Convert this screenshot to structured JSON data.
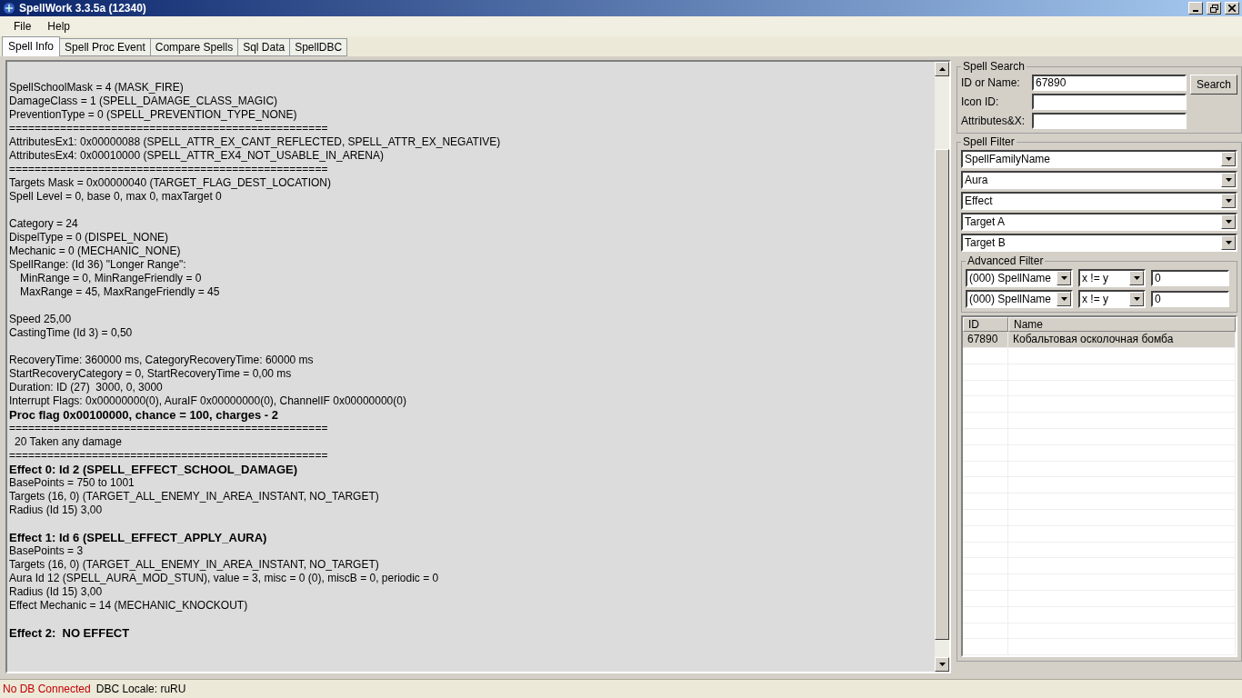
{
  "window": {
    "title": "SpellWork 3.3.5a (12340)"
  },
  "menu": [
    "File",
    "Help"
  ],
  "tabs": [
    {
      "label": "Spell Info",
      "selected": true
    },
    {
      "label": "Spell Proc Event",
      "selected": false
    },
    {
      "label": "Compare Spells",
      "selected": false
    },
    {
      "label": "Sql Data",
      "selected": false
    },
    {
      "label": "SpellDBC",
      "selected": false
    }
  ],
  "info_lines": [
    {
      "kind": "blank"
    },
    {
      "kind": "plain",
      "text": "SpellSchoolMask = 4 (MASK_FIRE)"
    },
    {
      "kind": "plain",
      "text": "DamageClass = 1 (SPELL_DAMAGE_CLASS_MAGIC)"
    },
    {
      "kind": "plain",
      "text": "PreventionType = 0 (SPELL_PREVENTION_TYPE_NONE)"
    },
    {
      "kind": "rule",
      "text": "=================================================="
    },
    {
      "kind": "plain",
      "text": "AttributesEx1: 0x00000088 (SPELL_ATTR_EX_CANT_REFLECTED, SPELL_ATTR_EX_NEGATIVE)"
    },
    {
      "kind": "plain",
      "text": "AttributesEx4: 0x00010000 (SPELL_ATTR_EX4_NOT_USABLE_IN_ARENA)"
    },
    {
      "kind": "rule",
      "text": "=================================================="
    },
    {
      "kind": "plain",
      "text": "Targets Mask = 0x00000040 (TARGET_FLAG_DEST_LOCATION)"
    },
    {
      "kind": "plain",
      "text": "Spell Level = 0, base 0, max 0, maxTarget 0"
    },
    {
      "kind": "blank"
    },
    {
      "kind": "plain",
      "text": "Category = 24"
    },
    {
      "kind": "plain",
      "text": "DispelType = 0 (DISPEL_NONE)"
    },
    {
      "kind": "plain",
      "text": "Mechanic = 0 (MECHANIC_NONE)"
    },
    {
      "kind": "plain",
      "text": "SpellRange: (Id 36) \"Longer Range\":"
    },
    {
      "kind": "indent",
      "text": "MinRange = 0, MinRangeFriendly = 0"
    },
    {
      "kind": "indent",
      "text": "MaxRange = 45, MaxRangeFriendly = 45"
    },
    {
      "kind": "blank"
    },
    {
      "kind": "plain",
      "text": "Speed 25,00"
    },
    {
      "kind": "plain",
      "text": "CastingTime (Id 3) = 0,50"
    },
    {
      "kind": "blank"
    },
    {
      "kind": "plain",
      "text": "RecoveryTime: 360000 ms, CategoryRecoveryTime: 60000 ms"
    },
    {
      "kind": "plain",
      "text": "StartRecoveryCategory = 0, StartRecoveryTime = 0,00 ms"
    },
    {
      "kind": "plain",
      "text": "Duration: ID (27)  3000, 0, 3000"
    },
    {
      "kind": "plain",
      "text": "Interrupt Flags: 0x00000000(0), AuraIF 0x00000000(0), ChannelIF 0x00000000(0)"
    },
    {
      "kind": "bold",
      "text": "Proc flag 0x00100000, chance = 100, charges - 2"
    },
    {
      "kind": "rule",
      "text": "=================================================="
    },
    {
      "kind": "small_indent",
      "text": "20 Taken any damage"
    },
    {
      "kind": "rule",
      "text": "=================================================="
    },
    {
      "kind": "bold",
      "text": "Effect 0: Id 2 (SPELL_EFFECT_SCHOOL_DAMAGE)"
    },
    {
      "kind": "plain",
      "text": "BasePoints = 750 to 1001"
    },
    {
      "kind": "plain",
      "text": "Targets (16, 0) (TARGET_ALL_ENEMY_IN_AREA_INSTANT, NO_TARGET)"
    },
    {
      "kind": "plain",
      "text": "Radius (Id 15) 3,00"
    },
    {
      "kind": "blank"
    },
    {
      "kind": "bold",
      "text": "Effect 1: Id 6 (SPELL_EFFECT_APPLY_AURA)"
    },
    {
      "kind": "plain",
      "text": "BasePoints = 3"
    },
    {
      "kind": "plain",
      "text": "Targets (16, 0) (TARGET_ALL_ENEMY_IN_AREA_INSTANT, NO_TARGET)"
    },
    {
      "kind": "plain",
      "text": "Aura Id 12 (SPELL_AURA_MOD_STUN), value = 3, misc = 0 (0), miscB = 0, periodic = 0"
    },
    {
      "kind": "plain",
      "text": "Radius (Id 15) 3,00"
    },
    {
      "kind": "plain",
      "text": "Effect Mechanic = 14 (MECHANIC_KNOCKOUT)"
    },
    {
      "kind": "blank"
    },
    {
      "kind": "bold",
      "text": "Effect 2:  NO EFFECT"
    }
  ],
  "spell_search": {
    "title": "Spell Search",
    "fields": [
      {
        "label": "ID or Name:",
        "value": "67890"
      },
      {
        "label": "Icon ID:"
      },
      {
        "label": "Attributes&X:"
      }
    ],
    "button": "Search"
  },
  "spell_filter": {
    "title": "Spell Filter",
    "dropdowns": [
      "SpellFamilyName",
      "Aura",
      "Effect",
      "Target A",
      "Target B"
    ]
  },
  "advanced_filter": {
    "title": "Advanced Filter",
    "rows": [
      {
        "field": "(000) SpellName",
        "operator": "x != y",
        "value": "0"
      },
      {
        "field": "(000) SpellName",
        "operator": "x != y",
        "value": "0"
      }
    ]
  },
  "results": {
    "columns": [
      "ID",
      "Name"
    ],
    "rows": [
      {
        "id": "67890",
        "name": "Кобальтовая осколочная бомба",
        "selected": true
      }
    ]
  },
  "status_bar": [
    {
      "kind": "error",
      "text": "No DB Connected"
    },
    {
      "kind": "info",
      "text": "DBC Locale: ruRU"
    }
  ]
}
